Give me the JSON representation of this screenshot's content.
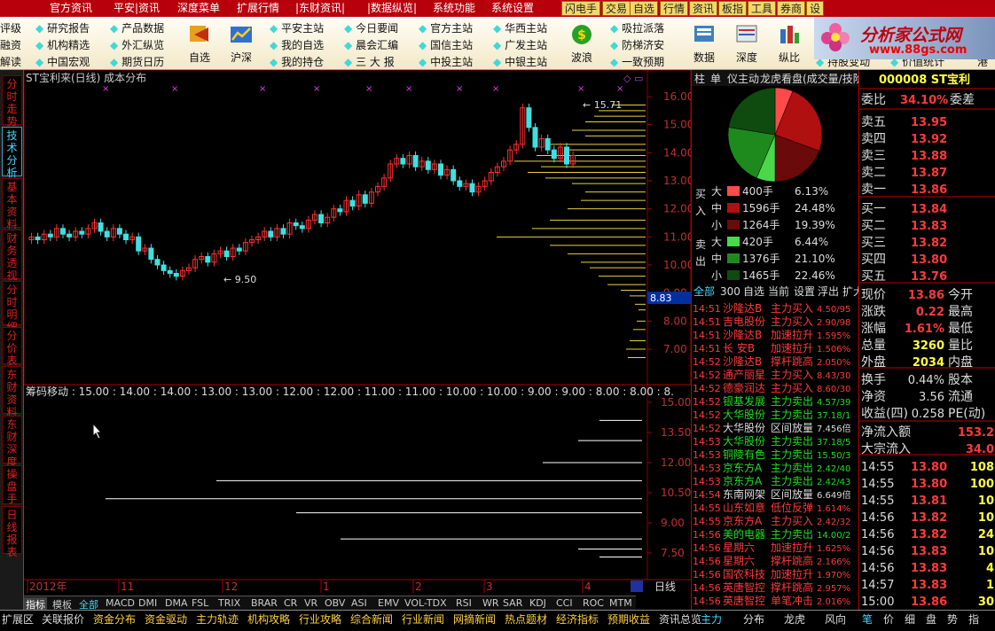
{
  "menubar": {
    "items": [
      "官方资讯",
      "平安|资讯",
      "深度菜单",
      "扩展行情",
      "|东财资讯|",
      "|数据纵览|",
      "系统功能",
      "系统设置"
    ],
    "tabs": [
      "闪电手",
      "交易",
      "自选",
      "行情",
      "资讯",
      "板指",
      "工具",
      "券商",
      "设"
    ]
  },
  "logo": {
    "title": "分析家公式网",
    "url": "www.88gs.com"
  },
  "toolbar": {
    "left_labels": [
      "评级",
      "融资",
      "解读"
    ],
    "col1": [
      "研究报告",
      "机构精选",
      "中国宏观"
    ],
    "col2": [
      "产品数据",
      "外汇纵览",
      "期货日历"
    ],
    "btn_zixuan": "自选",
    "btn_hushen": "沪深",
    "col3": [
      "平安主站",
      "我的自选",
      "我的持仓"
    ],
    "col4": [
      "今日要闻",
      "晨会汇编",
      "三 大 报"
    ],
    "col5": [
      "官方主站",
      "国信主站",
      "中投主站"
    ],
    "col6": [
      "华西主站",
      "广发主站",
      "中银主站"
    ],
    "btn_bolang": "波浪",
    "col7": [
      "吸拉派落",
      "防梯济安",
      "一致预期"
    ],
    "btn_shuju": "数据",
    "btn_shendu": "深度",
    "btn_zongbi": "纵比",
    "col8": [
      "持股变动"
    ],
    "col9": [
      "价值统计"
    ],
    "col10": [
      "港"
    ]
  },
  "left_tabs": [
    "分时走势",
    "技术分析",
    "基本资料",
    "财务透视",
    "分时明细",
    "分价表",
    "东财资料",
    "东财深度",
    "操盘手",
    "日线报表"
  ],
  "chart": {
    "title": "ST宝利来(日线) 成本分布",
    "price_labels": [
      "16.00",
      "15.00",
      "14.00",
      "13.00",
      "12.00",
      "11.00",
      "10.00",
      "9.00",
      "8.00",
      "7.00"
    ],
    "current_price_tag": "8.83",
    "max_label": "15.71",
    "min_label": "9.50",
    "lower_title": "筹码移动 : 15.00 : 14.00 : 14.00 : 13.00 : 13.00 : 12.00 : 12.00 : 11.00 : 11.00 : 10.00 : 10.00 : 9.00 : 9.00 : 8.00 : 8.00 : 8.",
    "lower_price_labels": [
      "15.00",
      "13.50",
      "12.00",
      "10.50",
      "9.00",
      "7.50"
    ],
    "time_axis": [
      "2012年",
      "11",
      "12",
      "1",
      "2",
      "3",
      "4"
    ],
    "period": "日线"
  },
  "chart_data": {
    "type": "candlestick",
    "title": "ST宝利来(日线) 成本分布",
    "ylim": [
      6.0,
      16.5
    ],
    "series": [
      {
        "name": "close",
        "values": [
          11.0,
          10.9,
          11.1,
          11.0,
          11.3,
          11.1,
          11.0,
          11.2,
          11.1,
          11.3,
          11.5,
          11.2,
          11.0,
          11.3,
          11.1,
          10.9,
          11.0,
          10.5,
          10.6,
          10.2,
          10.0,
          9.8,
          9.7,
          9.6,
          9.8,
          9.9,
          10.2,
          10.3,
          10.1,
          10.4,
          10.5,
          10.3,
          10.6,
          10.5,
          10.8,
          10.9,
          11.0,
          11.2,
          11.0,
          11.3,
          11.1,
          11.5,
          11.4,
          11.3,
          11.6,
          11.8,
          11.5,
          11.7,
          12.0,
          11.9,
          12.3,
          12.1,
          12.5,
          12.2,
          12.6,
          12.8,
          13.1,
          13.6,
          13.8,
          13.6,
          13.9,
          13.5,
          13.7,
          13.4,
          13.6,
          13.2,
          13.4,
          13.0,
          12.8,
          12.9,
          12.6,
          12.8,
          13.0,
          13.3,
          13.5,
          13.7,
          14.1,
          14.3,
          15.6,
          14.9,
          14.2,
          14.5,
          14.1,
          13.8,
          14.2,
          13.6,
          13.9
        ]
      }
    ]
  },
  "sidebar": {
    "tabs": [
      "柱",
      "单",
      "仪主动",
      "龙虎看盘(成交量/技阶"
    ],
    "buy_label": "买入",
    "sell_label": "卖出",
    "flow": [
      {
        "side": "买",
        "size": "大",
        "color": "#ff4a4a",
        "vol": "400手",
        "pct": "6.13%"
      },
      {
        "side": "入",
        "size": "中",
        "color": "#b01010",
        "vol": "1596手",
        "pct": "24.48%"
      },
      {
        "side": "",
        "size": "小",
        "color": "#6a0a0a",
        "vol": "1264手",
        "pct": "19.39%"
      },
      {
        "side": "卖",
        "size": "大",
        "color": "#4ad84a",
        "vol": "420手",
        "pct": "6.44%"
      },
      {
        "side": "出",
        "size": "中",
        "color": "#1e8a1e",
        "vol": "1376手",
        "pct": "21.10%"
      },
      {
        "side": "",
        "size": "小",
        "color": "#0f4a0f",
        "vol": "1465手",
        "pct": "22.46%"
      }
    ],
    "filter_tabs": [
      "全部",
      "300",
      "自选",
      "当前",
      "设置",
      "浮出",
      "扩大"
    ],
    "events": [
      [
        "14:51",
        "沙隆达B",
        "主力买入",
        "4.50/95",
        "r"
      ],
      [
        "14:51",
        "吉电股份",
        "主力买入",
        "2.90/98",
        "r"
      ],
      [
        "14:51",
        "沙隆达B",
        "加速拉升",
        "1.595%",
        "r"
      ],
      [
        "14:51",
        "长 安B",
        "加速拉升",
        "1.506%",
        "r"
      ],
      [
        "14:52",
        "沙隆达B",
        "撑杆跳高",
        "2.050%",
        "r"
      ],
      [
        "14:52",
        "通产丽星",
        "主力买入",
        "8.43/30",
        "r"
      ],
      [
        "14:52",
        "德豪润达",
        "主力买入",
        "8.60/30",
        "r"
      ],
      [
        "14:52",
        "银基发展",
        "主力卖出",
        "4.57/39",
        "g"
      ],
      [
        "14:52",
        "大华股份",
        "主力卖出",
        "37.18/1",
        "g"
      ],
      [
        "14:52",
        "大华股份",
        "区间放量",
        "7.456倍",
        "w"
      ],
      [
        "14:53",
        "大华股份",
        "主力卖出",
        "37.18/5",
        "g"
      ],
      [
        "14:53",
        "铜陵有色",
        "主力卖出",
        "15.50/3",
        "g"
      ],
      [
        "14:53",
        "京东方A",
        "主力卖出",
        "2.42/40",
        "g"
      ],
      [
        "14:53",
        "京东方A",
        "主力卖出",
        "2.42/43",
        "g"
      ],
      [
        "14:54",
        "东南网架",
        "区间放量",
        "6.649倍",
        "w"
      ],
      [
        "14:55",
        "山东如意",
        "低位反弹",
        "1.614%",
        "r"
      ],
      [
        "14:55",
        "京东方A",
        "主力买入",
        "2.42/32",
        "r"
      ],
      [
        "14:56",
        "美的电器",
        "主力卖出",
        "14.00/2",
        "g"
      ],
      [
        "14:56",
        "星期六",
        "加速拉升",
        "1.625%",
        "r"
      ],
      [
        "14:56",
        "星期六",
        "撑杆跳高",
        "2.166%",
        "r"
      ],
      [
        "14:56",
        "国农科技",
        "加速拉升",
        "1.970%",
        "r"
      ],
      [
        "14:56",
        "英唐智控",
        "撑杆跳高",
        "2.957%",
        "r"
      ],
      [
        "14:56",
        "英唐智控",
        "单笔冲击",
        "2.016%",
        "r"
      ]
    ]
  },
  "quote": {
    "code_name": "000008 ST宝利",
    "weibi_label": "委比",
    "weibi": "34.10%",
    "weicha_label": "委差",
    "asks": [
      [
        "卖五",
        "13.95"
      ],
      [
        "卖四",
        "13.92"
      ],
      [
        "卖三",
        "13.88"
      ],
      [
        "卖二",
        "13.87"
      ],
      [
        "卖一",
        "13.86"
      ]
    ],
    "bids": [
      [
        "买一",
        "13.84"
      ],
      [
        "买二",
        "13.83"
      ],
      [
        "买三",
        "13.82"
      ],
      [
        "买四",
        "13.80"
      ],
      [
        "买五",
        "13.76"
      ]
    ],
    "stats": [
      [
        "现价",
        "13.86",
        "今开"
      ],
      [
        "涨跌",
        "0.22",
        "最高"
      ],
      [
        "涨幅",
        "1.61%",
        "最低"
      ],
      [
        "总量",
        "3260",
        "量比"
      ],
      [
        "外盘",
        "2034",
        "内盘"
      ]
    ],
    "stats2": [
      [
        "换手",
        "0.44%",
        "股本"
      ],
      [
        "净资",
        "3.56",
        "流通"
      ],
      [
        "收益(四)",
        "0.258",
        "PE(动)"
      ]
    ],
    "flow": [
      [
        "净流入额",
        "153.2"
      ],
      [
        "大宗流入",
        "34.0"
      ]
    ],
    "ticks": [
      [
        "14:55",
        "13.80",
        "108"
      ],
      [
        "14:55",
        "13.80",
        "100"
      ],
      [
        "14:55",
        "13.81",
        "10"
      ],
      [
        "14:56",
        "13.82",
        "10"
      ],
      [
        "14:56",
        "13.82",
        "24"
      ],
      [
        "14:56",
        "13.83",
        "10"
      ],
      [
        "14:56",
        "13.83",
        "4"
      ],
      [
        "14:57",
        "13.83",
        "1"
      ],
      [
        "15:00",
        "13.86",
        "30"
      ]
    ]
  },
  "bottom": {
    "indicator_tabs": [
      "指标",
      "模板",
      "全部",
      "MACD",
      "DMI",
      "DMA",
      "FSL",
      "TRIX",
      "BRAR",
      "CR",
      "VR",
      "OBV",
      "ASI",
      "EMV",
      "VOL-TDX",
      "RSI",
      "WR",
      "SAR",
      "KDJ",
      "CCI",
      "ROC",
      "MTM",
      "BOLL",
      "PSY",
      "MCST"
    ],
    "nav_items": [
      "扩展区",
      "关联报价",
      "资金分布",
      "资金驱动",
      "主力轨迹",
      "机构攻略",
      "行业攻略",
      "综合新闻",
      "行业新闻",
      "网摘新闻",
      "热点题材",
      "经济指标",
      "预期收益",
      "资讯总览"
    ],
    "side_tabs": [
      "主力",
      "分布",
      "龙虎",
      "风向"
    ],
    "quote_tabs": [
      "笔",
      "价",
      "细",
      "盘",
      "势",
      "指"
    ]
  }
}
